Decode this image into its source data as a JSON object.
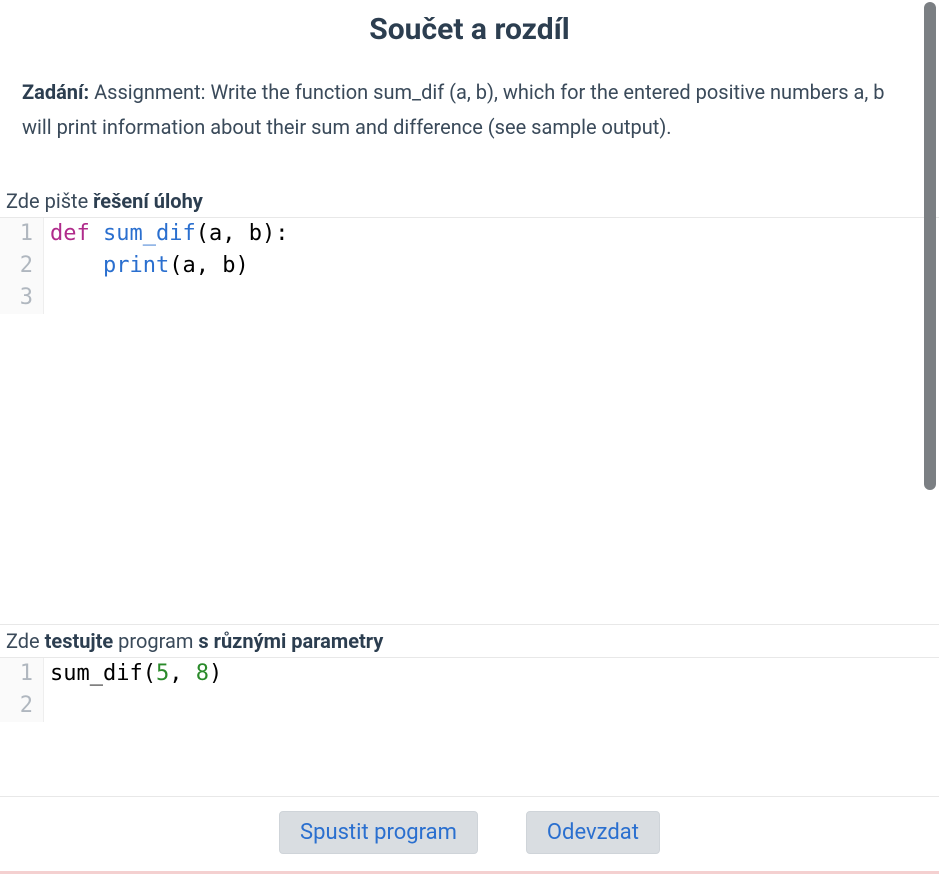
{
  "title": "Součet a rozdíl",
  "assignment": {
    "label": "Zadání:",
    "text": " Assignment: Write the function sum_dif (a, b), which for the entered positive numbers a, b will print information about their sum and difference (see sample output)."
  },
  "solution_section": {
    "prefix": "Zde pište ",
    "bold": "řešení úlohy"
  },
  "test_section": {
    "prefix": "Zde ",
    "bold1": "testujte",
    "mid": " program ",
    "bold2": "s různými parametry"
  },
  "solution_code": {
    "lines": [
      {
        "num": "1",
        "tokens": [
          {
            "cls": "tok-kw",
            "t": "def"
          },
          {
            "cls": "",
            "t": " "
          },
          {
            "cls": "tok-fn",
            "t": "sum_dif"
          },
          {
            "cls": "tok-punc",
            "t": "(a, b):"
          }
        ]
      },
      {
        "num": "2",
        "tokens": [
          {
            "cls": "",
            "t": "    "
          },
          {
            "cls": "tok-builtin",
            "t": "print"
          },
          {
            "cls": "tok-punc",
            "t": "(a, b)"
          }
        ]
      },
      {
        "num": "3",
        "tokens": []
      }
    ]
  },
  "test_code": {
    "lines": [
      {
        "num": "1",
        "tokens": [
          {
            "cls": "",
            "t": "sum_dif("
          },
          {
            "cls": "tok-num",
            "t": "5"
          },
          {
            "cls": "",
            "t": ", "
          },
          {
            "cls": "tok-num",
            "t": "8"
          },
          {
            "cls": "",
            "t": ")"
          }
        ]
      },
      {
        "num": "2",
        "tokens": []
      }
    ]
  },
  "buttons": {
    "run": "Spustit program",
    "submit": "Odevzdat"
  }
}
